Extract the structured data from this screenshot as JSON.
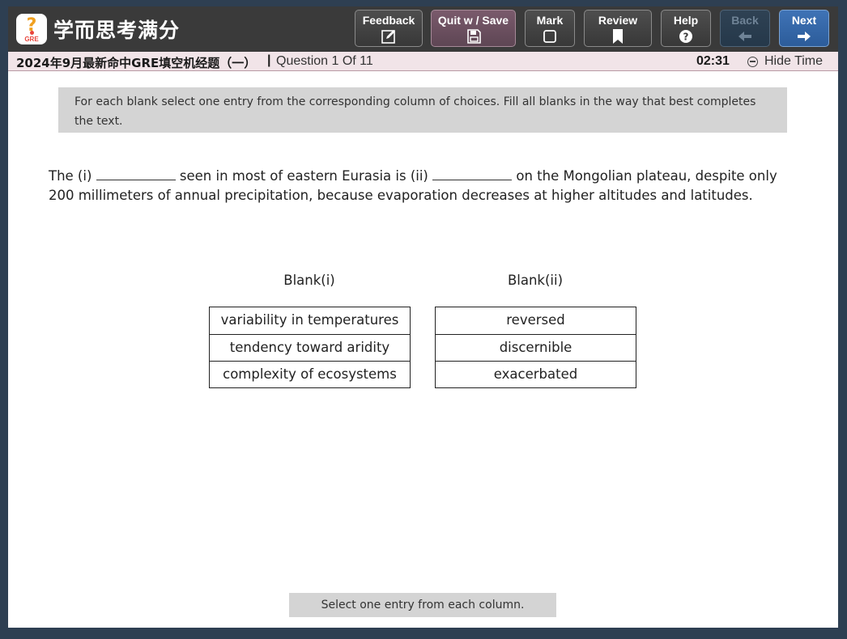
{
  "brand": {
    "name": "学而思考满分",
    "badge_text": "GRE",
    "badge_symbol": "?"
  },
  "toolbar": {
    "feedback": "Feedback",
    "quit_save": "Quit w / Save",
    "mark": "Mark",
    "review": "Review",
    "help": "Help",
    "back": "Back",
    "next": "Next"
  },
  "infobar": {
    "exam_title": "2024年9月最新命中GRE填空机经题（一）",
    "separator": "|",
    "question_counter": "Question 1 Of 11",
    "timer": "02:31",
    "hide_time": "Hide Time"
  },
  "instructions": "For each blank select one entry from the corresponding column of choices. Fill all blanks in the way that best completes the text.",
  "question": {
    "part1": "The (i) ",
    "part2": " seen in most of eastern Eurasia is (ii) ",
    "part3": " on the Mongolian plateau, despite only 200 millimeters of annual precipitation, because evaporation decreases at higher altitudes and latitudes."
  },
  "blanks": [
    {
      "title": "Blank(i)",
      "choices": [
        "variability in temperatures",
        "tendency toward aridity",
        "complexity of ecosystems"
      ]
    },
    {
      "title": "Blank(ii)",
      "choices": [
        "reversed",
        "discernible",
        "exacerbated"
      ]
    }
  ],
  "status": "Select one entry from each column.",
  "colors": {
    "background": "#2e3f52",
    "toolbar": "#3a3a3a",
    "quit_button": "#6b4f5f",
    "next_button": "#3566a8",
    "infobar": "#f1e4e8",
    "instruction_box": "#d4d4d4"
  },
  "icons": {
    "feedback": "edit-icon",
    "quit_save": "save-icon",
    "mark": "checkbox-icon",
    "review": "bookmark-icon",
    "help": "help-icon",
    "back": "arrow-left-icon",
    "next": "arrow-right-icon",
    "hide_time": "minus-circle-icon"
  }
}
